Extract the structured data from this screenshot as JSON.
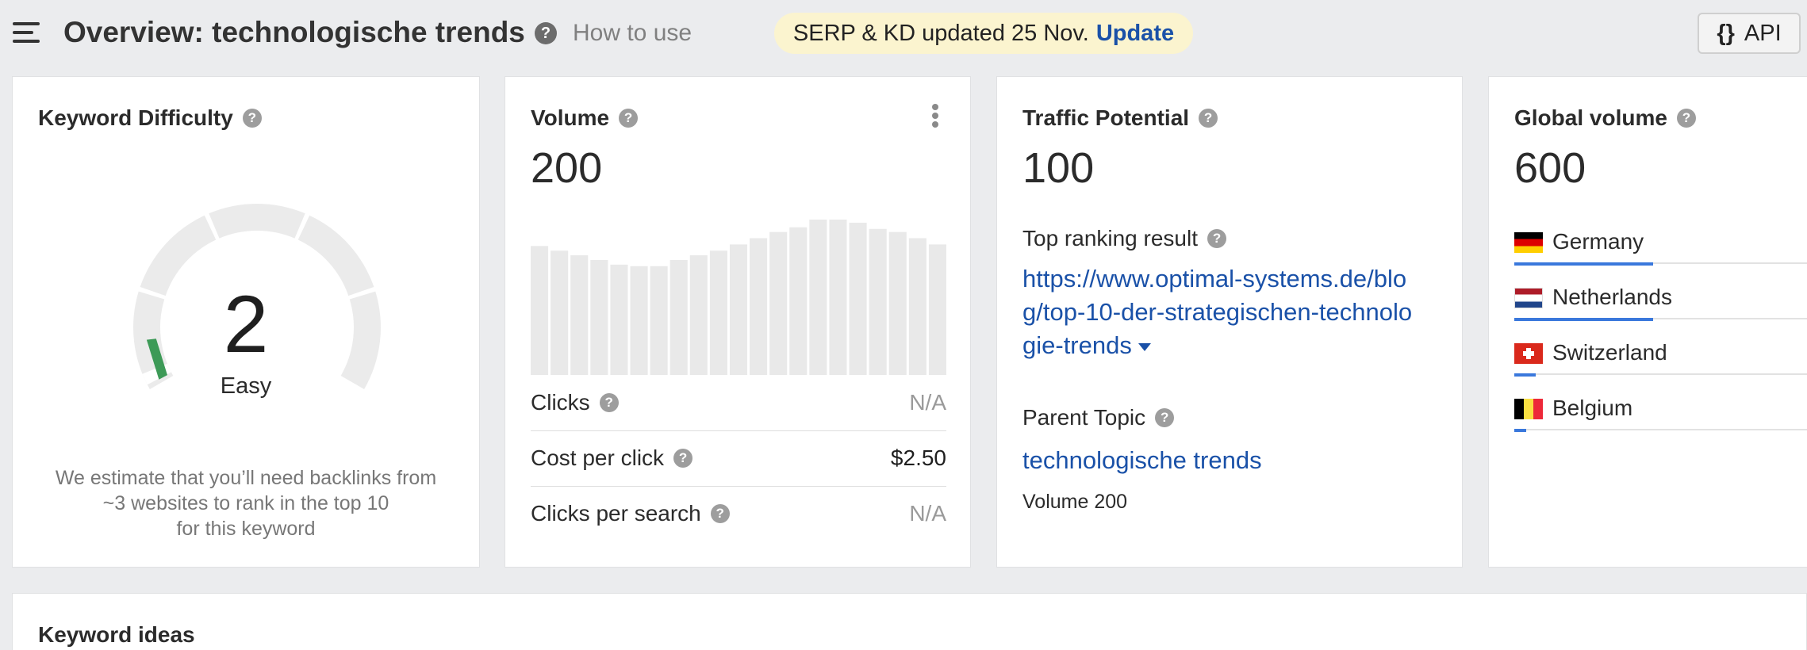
{
  "header": {
    "title": "Overview: technologische trends",
    "help_label": "How to use",
    "notice_text": "SERP & KD updated 25 Nov.",
    "notice_link": "Update",
    "api_braces": "{}",
    "api_label": "API"
  },
  "kd": {
    "title": "Keyword Difficulty",
    "value": "2",
    "label": "Easy",
    "note_lines": [
      "We estimate that you’ll need backlinks from",
      "~3 websites to rank in the top 10",
      "for this keyword"
    ],
    "score_fraction": 0.02,
    "bar_color": "#3d9a57"
  },
  "volume": {
    "title": "Volume",
    "value": "200",
    "trend_levels": [
      0.83,
      0.8,
      0.77,
      0.74,
      0.71,
      0.7,
      0.7,
      0.74,
      0.77,
      0.8,
      0.84,
      0.88,
      0.92,
      0.95,
      1.0,
      1.0,
      0.98,
      0.94,
      0.92,
      0.88,
      0.84
    ],
    "rows": [
      {
        "label": "Clicks",
        "value": "N/A"
      },
      {
        "label": "Cost per click",
        "value": "$2.50"
      },
      {
        "label": "Clicks per search",
        "value": "N/A"
      }
    ]
  },
  "traffic": {
    "title": "Traffic Potential",
    "value": "100",
    "top_result_label": "Top ranking result",
    "url_lines": [
      "https://www.optimal-systems.de/blo",
      "g/top-10-der-strategischen-technolo",
      "gie-trends"
    ],
    "parent_label": "Parent Topic",
    "parent_link": "technologische trends",
    "parent_volume": "Volume 200"
  },
  "global": {
    "title": "Global volume",
    "value": "600",
    "countries": [
      {
        "name": "Germany",
        "share": 0.46,
        "flag": [
          "#000000",
          "#dd0000",
          "#ffce00"
        ]
      },
      {
        "name": "Netherlands",
        "share": 0.46,
        "flag": [
          "#ae1c28",
          "#ffffff",
          "#21468b"
        ]
      },
      {
        "name": "Switzerland",
        "share": 0.07,
        "flag": [
          "#da291c"
        ]
      },
      {
        "name": "Belgium",
        "share": 0.04,
        "flag": [
          "#000000",
          "#fae042",
          "#ed2939"
        ]
      }
    ]
  },
  "ideas": {
    "title": "Keyword ideas"
  },
  "colors": {
    "link": "#1a51a8",
    "accent_bar": "#3a78dc",
    "notice_bg": "#fbf4cf"
  }
}
